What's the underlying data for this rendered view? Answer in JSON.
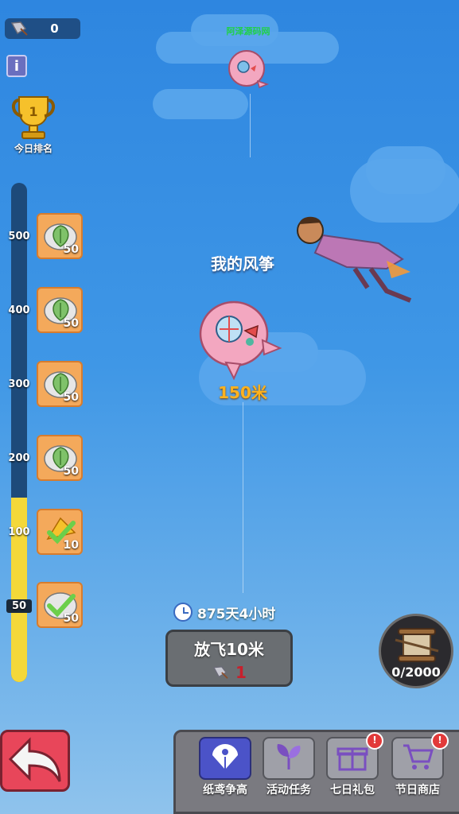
{
  "top": {
    "kite_count": "0",
    "info_label": "i"
  },
  "watermark": "阿泽源码网",
  "rank": {
    "label": "今日排名"
  },
  "progress": {
    "current_value": 150,
    "fill_fraction": 0.37,
    "ticks": [
      "500",
      "400",
      "300",
      "200",
      "100",
      "50"
    ]
  },
  "rewards": [
    {
      "count": "50",
      "icon": "cabbage-icon"
    },
    {
      "count": "50",
      "icon": "cabbage-icon"
    },
    {
      "count": "50",
      "icon": "cabbage-icon"
    },
    {
      "count": "50",
      "icon": "cabbage-icon"
    },
    {
      "count": "10",
      "icon": "leaf-check-icon"
    },
    {
      "count": "50",
      "icon": "cabbage-check-icon"
    }
  ],
  "kite": {
    "title": "我的风筝",
    "distance": "150米"
  },
  "timer": {
    "text": "875天4小时"
  },
  "fly_button": {
    "label": "放飞10米",
    "cost": "1"
  },
  "spool": {
    "value": "0/2000"
  },
  "tabs": [
    {
      "label": "纸鸢争高",
      "icon": "kite-icon",
      "active": true,
      "badge": ""
    },
    {
      "label": "活动任务",
      "icon": "sprout-icon",
      "active": false,
      "badge": ""
    },
    {
      "label": "七日礼包",
      "icon": "gift-icon",
      "active": false,
      "badge": "!"
    },
    {
      "label": "节日商店",
      "icon": "cart-icon",
      "active": false,
      "badge": "!"
    }
  ],
  "colors": {
    "sky": "#3f97e6",
    "progress_fill": "#f4d83a",
    "distance": "#ffb21e",
    "tab_active": "#4b53c8",
    "badge": "#e23a3a"
  }
}
